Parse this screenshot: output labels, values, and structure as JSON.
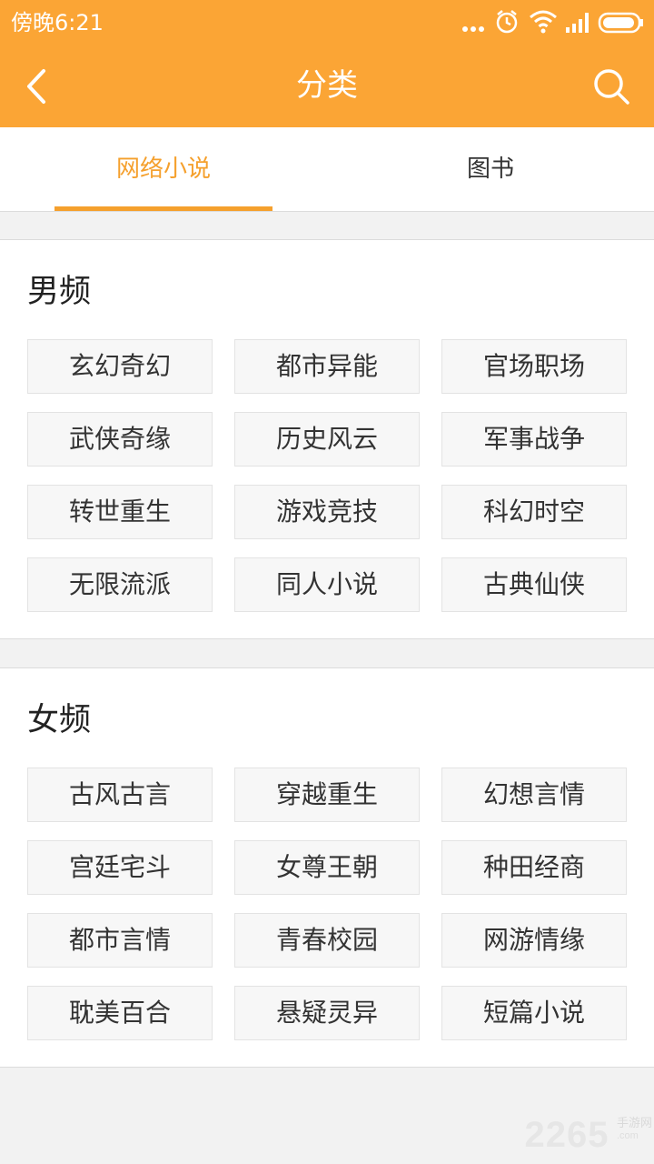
{
  "status_bar": {
    "time": "傍晚6:21",
    "icons": [
      "more-dots-icon",
      "alarm-icon",
      "wifi-icon",
      "signal-icon",
      "battery-icon"
    ]
  },
  "header": {
    "title": "分类",
    "back_icon": "chevron-left-icon",
    "search_icon": "search-icon",
    "background_color": "#fba535"
  },
  "tabs": [
    {
      "label": "网络小说",
      "active": true
    },
    {
      "label": "图书",
      "active": false
    }
  ],
  "accent_color": "#f5a02d",
  "sections": [
    {
      "title": "男频",
      "categories": [
        "玄幻奇幻",
        "都市异能",
        "官场职场",
        "武侠奇缘",
        "历史风云",
        "军事战争",
        "转世重生",
        "游戏竞技",
        "科幻时空",
        "无限流派",
        "同人小说",
        "古典仙侠"
      ]
    },
    {
      "title": "女频",
      "categories": [
        "古风古言",
        "穿越重生",
        "幻想言情",
        "宫廷宅斗",
        "女尊王朝",
        "种田经商",
        "都市言情",
        "青春校园",
        "网游情缘",
        "耽美百合",
        "悬疑灵异",
        "短篇小说"
      ]
    }
  ],
  "watermark": {
    "number": "2265",
    "text": "手游网",
    "suffix": ".com"
  }
}
